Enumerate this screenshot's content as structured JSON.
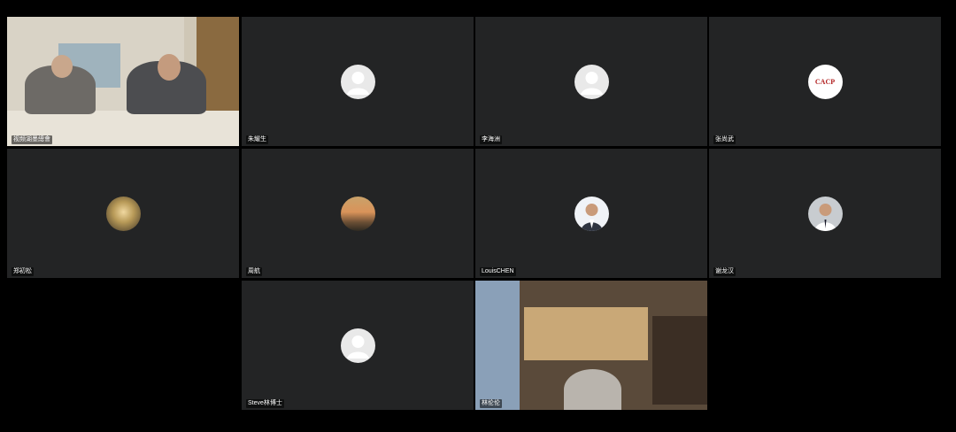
{
  "participants": [
    {
      "name": "视频湖墨總會",
      "avatar": "video-feed-meeting-room"
    },
    {
      "name": "朱耀生",
      "avatar": "default-person-icon"
    },
    {
      "name": "李海洲",
      "avatar": "default-person-icon"
    },
    {
      "name": "张尚武",
      "avatar": "cacp-logo"
    },
    {
      "name": "郑初松",
      "avatar": "photo-avatar"
    },
    {
      "name": "周航",
      "avatar": "photo-avatar"
    },
    {
      "name": "LouisCHEN",
      "avatar": "photo-avatar"
    },
    {
      "name": "谢龙汉",
      "avatar": "photo-avatar"
    },
    {
      "name": "Steve林博士",
      "avatar": "default-person-icon"
    },
    {
      "name": "林伦伦",
      "avatar": "video-feed-bookshelf"
    }
  ],
  "cacp_logo_text": "CACP",
  "colors": {
    "active_speaker_border": "#4fd15a",
    "tile_bg": "#232425",
    "background": "#000000"
  }
}
